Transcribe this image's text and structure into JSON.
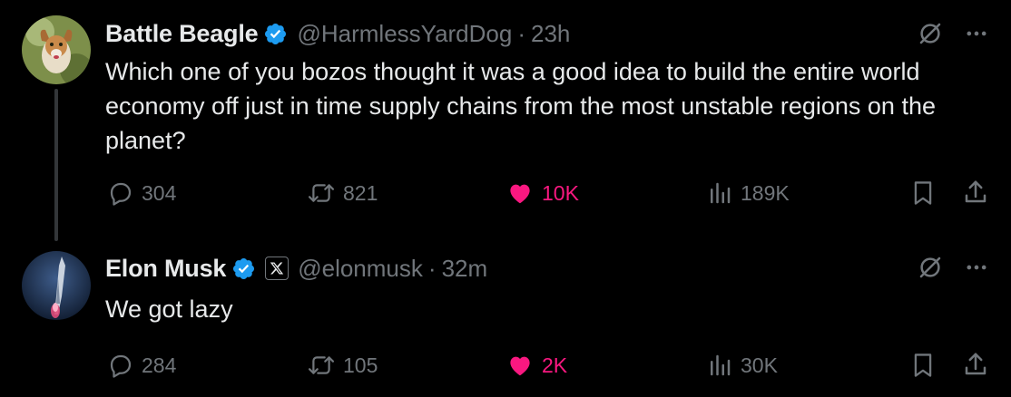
{
  "tweets": [
    {
      "author_name": "Battle Beagle",
      "handle": "@HarmlessYardDog",
      "separator": "·",
      "time": "23h",
      "text": "Which one of you bozos thought it was a good idea to build the entire world economy off just in time supply chains from the most unstable regions on the planet?",
      "replies": "304",
      "reposts": "821",
      "likes": "10K",
      "views": "189K"
    },
    {
      "author_name": "Elon Musk",
      "handle": "@elonmusk",
      "separator": "·",
      "time": "32m",
      "text": "We got lazy",
      "replies": "284",
      "reposts": "105",
      "likes": "2K",
      "views": "30K"
    }
  ],
  "colors": {
    "background": "#000000",
    "text": "#e7e9ea",
    "secondary": "#71767b",
    "verified": "#1d9bf0",
    "like": "#f91880"
  },
  "icons": [
    "verified-badge-icon",
    "x-affiliate-icon",
    "grok-icon",
    "more-icon",
    "reply-icon",
    "repost-icon",
    "like-icon",
    "views-icon",
    "bookmark-icon",
    "share-icon"
  ]
}
